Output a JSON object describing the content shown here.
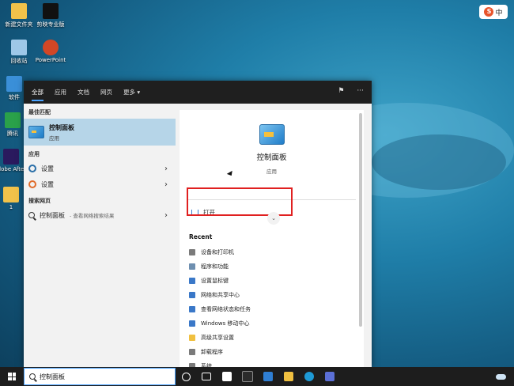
{
  "desktop": {
    "icons": [
      {
        "label": "新建文件夹",
        "color": "#f1c24a"
      },
      {
        "label": "剪映专业版",
        "color": "#111111"
      },
      {
        "label": "回收站",
        "color": "#9ec8e8"
      },
      {
        "label": "PowerPoint",
        "color": "#d24726"
      },
      {
        "label": "软件",
        "color": "#3a8fd8"
      },
      {
        "label": "腾讯",
        "color": "#2aa14a"
      },
      {
        "label": "Adobe After Effects",
        "color": "#2a1a5e"
      },
      {
        "label": "1",
        "color": "#f1c24a"
      }
    ],
    "ime_label": "中",
    "ime_logo": "S"
  },
  "search_panel": {
    "tabs": [
      "全部",
      "应用",
      "文档",
      "网页",
      "更多 ▾"
    ],
    "active_tab": "全部",
    "best_match_title": "最佳匹配",
    "best_match": {
      "name": "控制面板",
      "type": "应用"
    },
    "apps_title": "应用",
    "apps": [
      {
        "label": "设置"
      },
      {
        "label": "设置"
      }
    ],
    "web_title": "搜索网页",
    "web": {
      "label": "控制面板",
      "sub": "- 查看网络搜索结果"
    },
    "detail": {
      "title": "控制面板",
      "subtitle": "应用",
      "open_label": "打开",
      "recent_title": "Recent",
      "recent": [
        "设备和打印机",
        "程序和功能",
        "设置鼠标键",
        "网络和共享中心",
        "查看网络状态和任务",
        "Windows 移动中心",
        "高级共享设置",
        "卸载程序",
        "系统"
      ]
    }
  },
  "taskbar": {
    "search_value": "控制面板"
  },
  "colors": {
    "accent": "#4aa3ff",
    "highlight": "#b6d5e8",
    "annotation": "#e02020"
  }
}
